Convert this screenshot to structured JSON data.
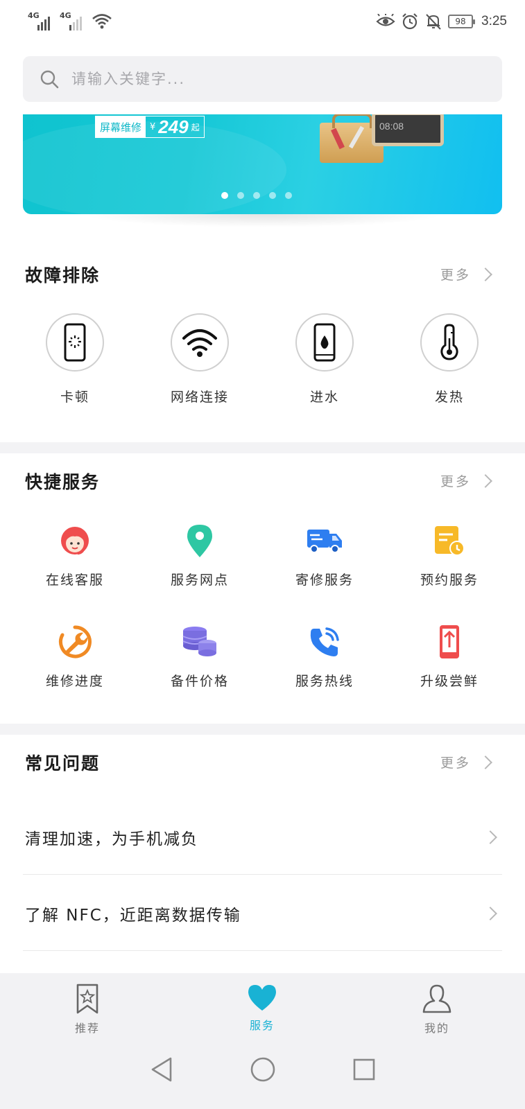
{
  "status_bar": {
    "signal1_label": "4G",
    "signal2_label": "4G",
    "battery": "98",
    "time": "3:25"
  },
  "search": {
    "placeholder": "请输入关键字..."
  },
  "banner": {
    "promo_tag": "屏幕维修",
    "currency": "¥",
    "price": "249",
    "price_suffix": "起",
    "device_time": "08:08",
    "slide_count": 5,
    "active_slide": 1
  },
  "troubleshoot": {
    "title": "故障排除",
    "more": "更多",
    "items": [
      {
        "label": "卡顿",
        "icon": "phone-lag-icon"
      },
      {
        "label": "网络连接",
        "icon": "wifi-icon"
      },
      {
        "label": "进水",
        "icon": "phone-water-icon"
      },
      {
        "label": "发热",
        "icon": "thermometer-icon"
      }
    ]
  },
  "quick_services": {
    "title": "快捷服务",
    "more": "更多",
    "items": [
      {
        "label": "在线客服",
        "icon": "customer-service-icon",
        "color": "#ef4d4d"
      },
      {
        "label": "服务网点",
        "icon": "location-pin-icon",
        "color": "#2ec7a3"
      },
      {
        "label": "寄修服务",
        "icon": "delivery-truck-icon",
        "color": "#2e7ef0"
      },
      {
        "label": "预约服务",
        "icon": "calendar-clock-icon",
        "color": "#f7b928"
      },
      {
        "label": "维修进度",
        "icon": "wrench-progress-icon",
        "color": "#f08a24"
      },
      {
        "label": "备件价格",
        "icon": "coin-stack-icon",
        "color": "#7a6ee0"
      },
      {
        "label": "服务热线",
        "icon": "phone-call-icon",
        "color": "#2e7ef0"
      },
      {
        "label": "升级尝鲜",
        "icon": "phone-upgrade-icon",
        "color": "#ef4d4d"
      }
    ]
  },
  "faq": {
    "title": "常见问题",
    "more": "更多",
    "items": [
      {
        "text": "清理加速，为手机减负"
      },
      {
        "text": "了解 NFC，近距离数据传输"
      }
    ]
  },
  "bottom_nav": {
    "tabs": [
      {
        "label": "推荐",
        "icon": "bookmark-star-icon"
      },
      {
        "label": "服务",
        "icon": "heart-icon",
        "active": true
      },
      {
        "label": "我的",
        "icon": "person-icon"
      }
    ],
    "accent": "#19b2d4"
  }
}
